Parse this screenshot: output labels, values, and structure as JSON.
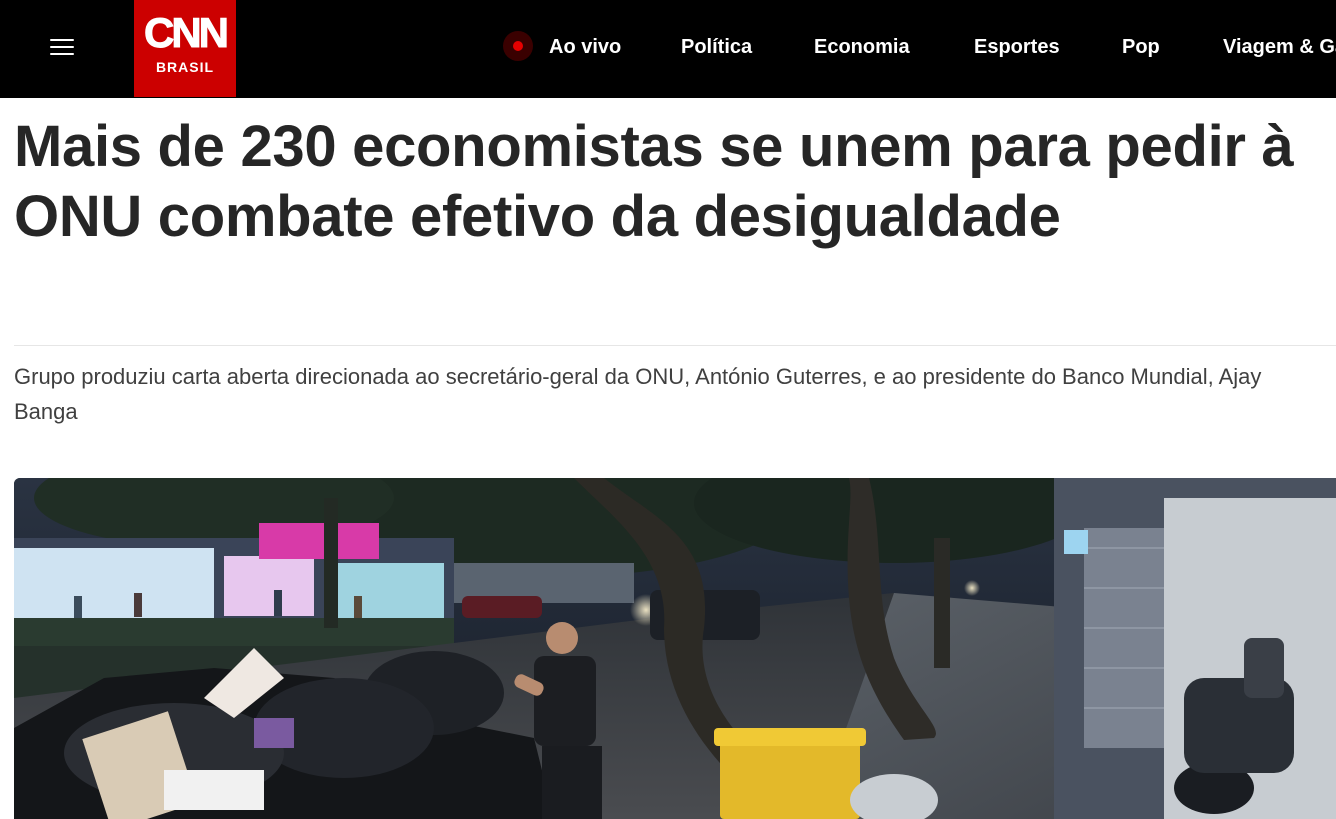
{
  "header": {
    "menu_icon": "hamburger-menu-icon",
    "logo": {
      "brand": "CNN",
      "sub": "BRASIL",
      "bg_color": "#cc0000"
    },
    "nav": [
      {
        "label": "Ao vivo",
        "icon": "live-record-dot-icon",
        "live": true
      },
      {
        "label": "Política"
      },
      {
        "label": "Economia"
      },
      {
        "label": "Esportes"
      },
      {
        "label": "Pop"
      },
      {
        "label": "Viagem & Gastronomia"
      }
    ]
  },
  "article": {
    "headline": "Mais de 230 economistas se unem para pedir à ONU combate efetivo da desigualdade",
    "subheadline": "Grupo produziu carta aberta direcionada ao secretário-geral da ONU, António Guterres, e ao presidente do Banco Mundial, Ajay Banga"
  },
  "colors": {
    "header_bg": "#000000",
    "brand_red": "#cc0000",
    "headline": "#262626",
    "body_text": "#404040",
    "live_dot": "#e60000"
  }
}
